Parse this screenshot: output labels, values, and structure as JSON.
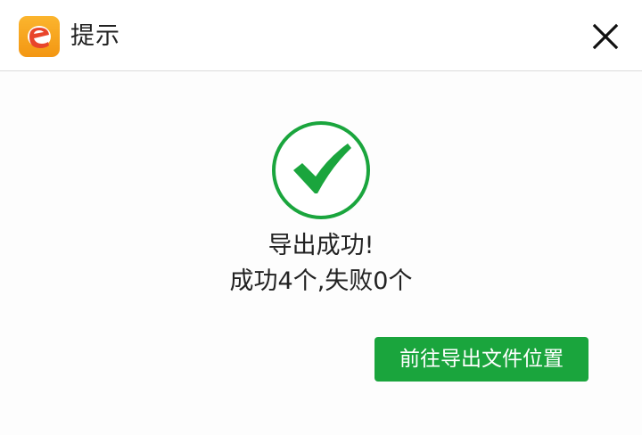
{
  "window": {
    "title": "提示",
    "logo_icon": "e-logo-icon",
    "close_icon": "close-icon"
  },
  "message": {
    "status_icon": "checkmark-circle-icon",
    "line1": "导出成功!",
    "line2": "成功4个,失败0个"
  },
  "actions": {
    "open_location_label": "前往导出文件位置"
  },
  "colors": {
    "accent_green": "#1aa53d",
    "logo_orange": "#f7a21b",
    "logo_red": "#e8452b"
  }
}
